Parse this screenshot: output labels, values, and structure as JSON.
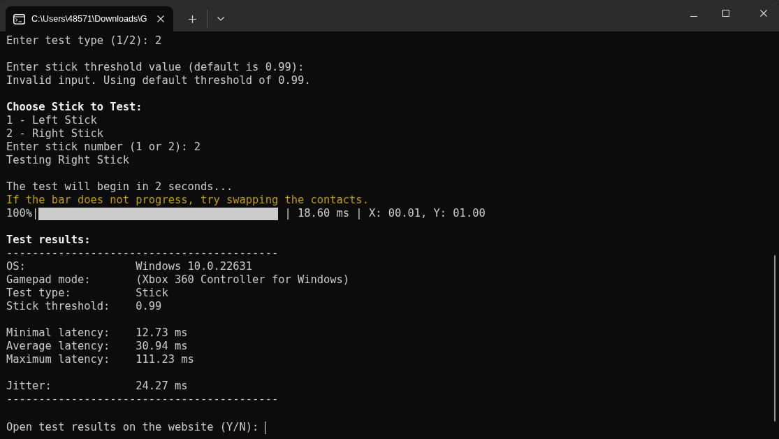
{
  "window": {
    "tab_title": "C:\\Users\\48571\\Downloads\\G"
  },
  "lines": [
    {
      "kind": "text",
      "text": "Enter test type (1/2): 2"
    },
    {
      "kind": "blank"
    },
    {
      "kind": "text",
      "text": "Enter stick threshold value (default is 0.99):"
    },
    {
      "kind": "text",
      "text": "Invalid input. Using default threshold of 0.99."
    },
    {
      "kind": "blank"
    },
    {
      "kind": "heading",
      "text": "Choose Stick to Test:"
    },
    {
      "kind": "text",
      "text": "1 - Left Stick"
    },
    {
      "kind": "text",
      "text": "2 - Right Stick"
    },
    {
      "kind": "text",
      "text": "Enter stick number (1 or 2): 2"
    },
    {
      "kind": "text",
      "text": "Testing Right Stick"
    },
    {
      "kind": "blank"
    },
    {
      "kind": "text",
      "text": "The test will begin in 2 seconds..."
    },
    {
      "kind": "warning",
      "text": "If the bar does not progress, try swapping the contacts."
    },
    {
      "kind": "progress",
      "prefix": "100%|",
      "level": 1.0,
      "suffix": " | 18.60 ms | X: 00.01, Y: 01.00"
    },
    {
      "kind": "blank"
    },
    {
      "kind": "heading",
      "text": "Test results:"
    },
    {
      "kind": "text",
      "text": "------------------------------------------"
    },
    {
      "kind": "field",
      "label": "OS:",
      "value": "Windows 10.0.22631"
    },
    {
      "kind": "field",
      "label": "Gamepad mode:",
      "value": "(Xbox 360 Controller for Windows)"
    },
    {
      "kind": "field",
      "label": "Test type:",
      "value": "Stick"
    },
    {
      "kind": "field",
      "label": "Stick threshold:",
      "value": "0.99"
    },
    {
      "kind": "blank"
    },
    {
      "kind": "field",
      "label": "Minimal latency:",
      "value": "12.73 ms"
    },
    {
      "kind": "field",
      "label": "Average latency:",
      "value": "30.94 ms"
    },
    {
      "kind": "field",
      "label": "Maximum latency:",
      "value": "111.23 ms"
    },
    {
      "kind": "blank"
    },
    {
      "kind": "field",
      "label": "Jitter:",
      "value": "24.27 ms"
    },
    {
      "kind": "text",
      "text": "------------------------------------------"
    },
    {
      "kind": "blank"
    },
    {
      "kind": "prompt",
      "text": "Open test results on the website (Y/N):"
    }
  ]
}
